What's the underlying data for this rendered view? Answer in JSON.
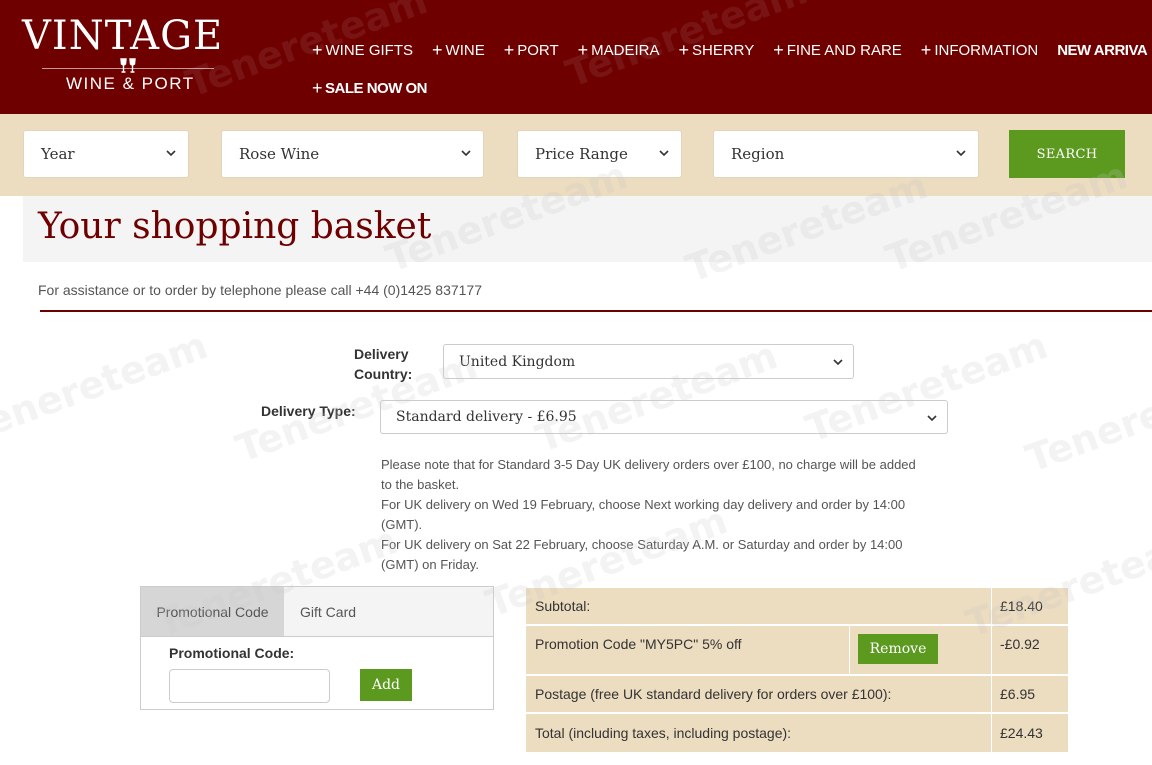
{
  "header": {
    "logo_main": "VINTAGE",
    "logo_sub": "WINE & PORT",
    "nav": [
      {
        "label": "WINE GIFTS",
        "bold": false
      },
      {
        "label": "WINE",
        "bold": false
      },
      {
        "label": "PORT",
        "bold": false
      },
      {
        "label": "MADEIRA",
        "bold": false
      },
      {
        "label": "SHERRY",
        "bold": false
      },
      {
        "label": "FINE AND RARE",
        "bold": false
      },
      {
        "label": "INFORMATION",
        "bold": false
      },
      {
        "label": "NEW ARRIVA",
        "bold": true
      }
    ],
    "nav_row2": {
      "label": "SALE NOW ON",
      "bold": true
    },
    "plus_glyph": "+"
  },
  "search": {
    "year": "Year",
    "type": "Rose Wine",
    "price": "Price Range",
    "region": "Region",
    "button": "SEARCH"
  },
  "basket": {
    "title": "Your shopping basket",
    "assist": "For assistance or to order by telephone please call +44 (0)1425 837177"
  },
  "delivery": {
    "country_label_1": "Delivery",
    "country_label_2": "Country:",
    "country_value": "United Kingdom",
    "type_label": "Delivery Type:",
    "type_value": "Standard delivery - £6.95",
    "note_1a": "Please note that for Standard 3-5 Day UK delivery orders over £100, no charge will be added",
    "note_1b": "to the basket.",
    "note_2a": "For UK delivery on Wed 19 February, choose Next working day delivery and order by 14:00",
    "note_2b": "(GMT).",
    "note_3a": "For UK delivery on Sat 22 February, choose Saturday A.M. or Saturday and order by 14:00",
    "note_3b": "(GMT) on Friday."
  },
  "promo": {
    "tab_promo": "Promotional Code",
    "tab_gift": "Gift Card",
    "label": "Promotional Code:",
    "input_value": "",
    "add_button": "Add"
  },
  "totals": {
    "subtotal_label": "Subtotal:",
    "subtotal_value": "£18.40",
    "promo_label": "Promotion Code \"MY5PC\" 5% off",
    "remove_button": "Remove",
    "promo_value": "-£0.92",
    "postage_label": "Postage (free UK standard delivery for orders over £100):",
    "postage_value": "£6.95",
    "total_label": "Total (including taxes, including postage):",
    "total_value": "£24.43"
  },
  "colors": {
    "brand": "#6e0000",
    "beige": "#ecdcc0",
    "green": "#5c9a1f"
  },
  "watermark": "Tenereteam"
}
